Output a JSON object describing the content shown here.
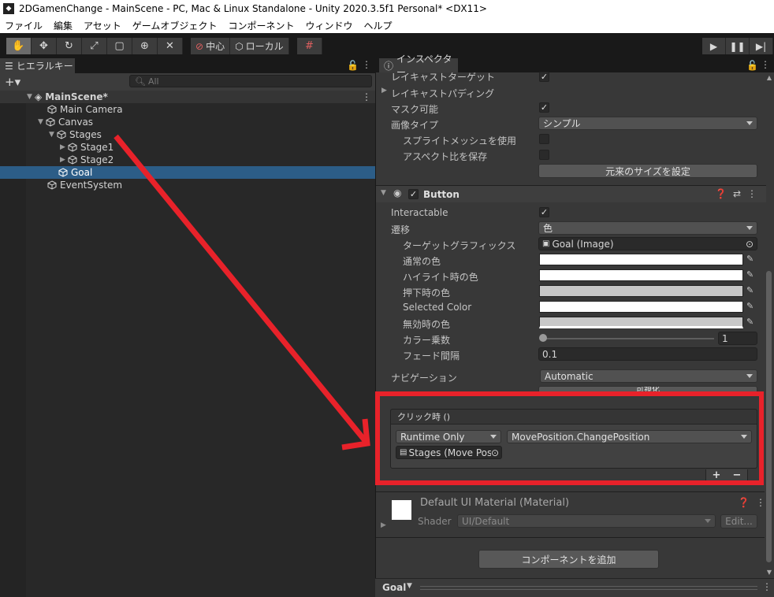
{
  "window": {
    "title": "2DGamenChange - MainScene - PC, Mac & Linux Standalone - Unity 2020.3.5f1 Personal* <DX11>"
  },
  "menu": [
    "ファイル",
    "編集",
    "アセット",
    "ゲームオブジェクト",
    "コンポーネント",
    "ウィンドウ",
    "ヘルプ"
  ],
  "toolbar": {
    "pivot_label": "中心",
    "space_label": "ローカル"
  },
  "hierarchy": {
    "tab_label": "ヒエラルキー",
    "search_placeholder": "All",
    "scene": "MainScene*",
    "items": [
      {
        "label": "Main Camera"
      },
      {
        "label": "Canvas"
      },
      {
        "label": "Stages"
      },
      {
        "label": "Stage1"
      },
      {
        "label": "Stage2"
      },
      {
        "label": "Goal"
      },
      {
        "label": "EventSystem"
      }
    ]
  },
  "inspector": {
    "tab_label": "インスペクター",
    "image": {
      "raycast_target": "レイキャストターゲット",
      "raycast_padding": "レイキャストパディング",
      "maskable": "マスク可能",
      "image_type": "画像タイプ",
      "image_type_value": "シンプル",
      "use_sprite_mesh": "スプライトメッシュを使用",
      "preserve_aspect": "アスペクト比を保存",
      "set_native_size": "元来のサイズを設定"
    },
    "button": {
      "title": "Button",
      "interactable": "Interactable",
      "transition": "遷移",
      "transition_value": "色",
      "target_graphic": "ターゲットグラフィックス",
      "target_graphic_value": "Goal (Image)",
      "normal_color": "通常の色",
      "highlighted_color": "ハイライト時の色",
      "pressed_color": "押下時の色",
      "selected_color": "Selected Color",
      "disabled_color": "無効時の色",
      "color_multiplier": "カラー乗数",
      "color_multiplier_value": "1",
      "fade_duration": "フェード間隔",
      "fade_duration_value": "0.1",
      "navigation": "ナビゲーション",
      "navigation_value": "Automatic",
      "visualize": "可視化"
    },
    "on_click": {
      "header": "クリック時 ()",
      "runtime": "Runtime Only",
      "function": "MovePosition.ChangePosition",
      "object": "Stages (Move Pos"
    },
    "material": {
      "title": "Default UI Material (Material)",
      "shader_label": "Shader",
      "shader_value": "UI/Default",
      "edit_label": "Edit..."
    },
    "add_component": "コンポーネントを追加",
    "footer_label": "Goal"
  },
  "colors": {
    "highlight": "#e8222a",
    "selection": "#2c5d87"
  }
}
